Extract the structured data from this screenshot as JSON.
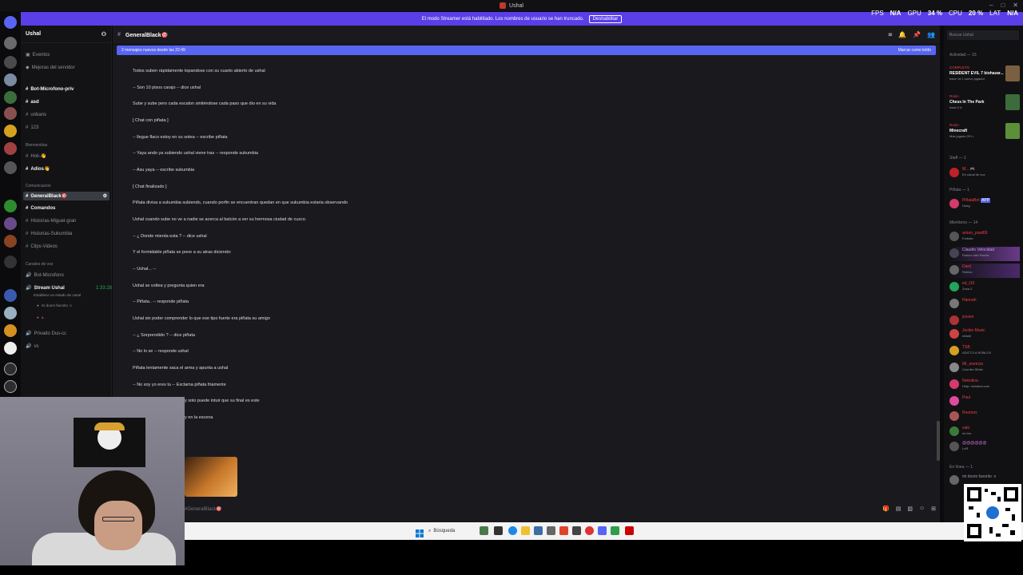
{
  "titlebar": {
    "title": "Ushal"
  },
  "perf": {
    "fps_label": "FPS",
    "fps": "N/A",
    "gpu_label": "GPU",
    "gpu": "34 %",
    "cpu_label": "CPU",
    "cpu": "20 %",
    "lat_label": "LAT",
    "lat": "N/A"
  },
  "streamer_bar": {
    "text": "El modo Streamer está habilitado. Los nombres de usuario se han truncado.",
    "button": "Deshabilitar"
  },
  "server": {
    "name": "Ushal"
  },
  "sidebar": {
    "top": [
      "Eventos",
      "Mejoras del servidor"
    ],
    "channels_a": [
      "Bot-Microfono-priv",
      "asd",
      "unbans",
      "123"
    ],
    "cat_bienvenidas": "Bienvenidas",
    "channels_b": [
      "Holi-👋",
      "Adios👋"
    ],
    "cat_comunicacion": "Comunicacion",
    "active_channel": "GeneralBlack🎯",
    "channels_c": [
      "Comandos",
      "Historias-Miguel-gran",
      "Historias-Sukumbia",
      "Clips-Videos"
    ],
    "cat_voz": "Canales de voz",
    "voice_a": "Bot-Microfono",
    "stream_channel": "Stream Ushal",
    "stream_time": "1:33:28",
    "stream_sub": "Establece un estado de canal",
    "voice_user_1": "mi doom favorito :v",
    "voice_user_2": "u..",
    "voice_b": "Privado Dus-cc",
    "voice_c": "vs"
  },
  "chat": {
    "channel": "GeneralBlack🎯",
    "new_messages": "2 mensajes nuevos desde las 22:49",
    "mark_read": "Marcar como leído",
    "messages": [
      "Todos suben rápidamente topandose con su cuarto abierto de ushal",
      "-- Son 10 pisos carajo -- dice ushal",
      "Sube y sube pero cada escalon sintiéndose cada paso que dio en su vida",
      "[ Chat con piñata ]",
      "-- llegue flaco estoy en su sotea -- escribe piñata",
      "-- Yaya ando ya subiendo ushal viene tras -- responde sukumbia",
      "-- Asu yaya -- escribe sukumbia",
      "[ Chat finalizado ]",
      "Piñata divisa a sukumbia subiendo, cuando porfin se encuentran quedan en que sukumbia estaria observando",
      "Ushal cuando sube no ve a nadie se acerca al balcón a ver su hermosa ciudad de cuzco.",
      "-- ¿ Donde mierda esta ? -- dice ushal",
      "Y el formidable piñata se pone a su atras diciendo:",
      "-- Ushal... --",
      "Ushal se voltea y pregunta quien era",
      "-- Piñata.. -- responde piñata",
      "Ushal sin poder comprender lo que ese tipo fuerte era piñata su amigo",
      "-- ¿ Sorprendido ? -- dice piñata",
      "-- No lo se -- responde ushal",
      "Piñata lentamente saca el arma y apunta a ushal",
      "-- No soy yo eres tu -- Exclama piñata friamente",
      "y solo puede intuir que su final es este",
      "y en la escena"
    ],
    "composer_placeholder": "#GeneralBlack🎯"
  },
  "members": {
    "search_placeholder": "Buscar Ushal",
    "activity_header": "Actividad — 15",
    "activities": [
      {
        "tag": "COMPLETO",
        "title": "RESIDENT EVIL 7 biohazar...",
        "sub": "hace 1d  1 nuevo jugador"
      },
      {
        "tag": "Ronin",
        "title": "Chess In The Park",
        "sub": "hace 2 d"
      },
      {
        "tag": "Ronin",
        "title": "Minecraft",
        "sub": "Más jugado 29 h"
      }
    ],
    "staff_header": "Staff — 1",
    "staff": [
      {
        "name": "M... 🎮",
        "sub": "En canal de voz"
      }
    ],
    "pinata_header": "Piñata — 1",
    "pinata": [
      {
        "name": "PiñataBot",
        "badge": "APP",
        "sub": "Hueg"
      }
    ],
    "members_header": "Miembros — 14",
    "list": [
      {
        "name": "arturo_prad69",
        "sub": "Fortnite"
      },
      {
        "name": "Claudio Velocidad",
        "sub": "Roblox with Rande"
      },
      {
        "name": "Dard",
        "sub": "Roblox"
      },
      {
        "name": "ed_t15",
        "sub": "Zona 2"
      },
      {
        "name": "Hannah",
        "sub": ""
      },
      {
        "name": "jessen",
        "sub": ""
      },
      {
        "name": "Jockie Music",
        "sub": "mfade"
      },
      {
        "name": "TSB",
        "sub": "ADICTO A ROBLOX"
      },
      {
        "name": "Mr_esencia",
        "sub": "Counter-Strike"
      },
      {
        "name": "Nekotina",
        "sub": "Help: nekotina.com"
      },
      {
        "name": "Paul",
        "sub": ""
      },
      {
        "name": "Roomes",
        "sub": ""
      },
      {
        "name": "valo",
        "sub": "en bro"
      },
      {
        "name": "@@@@@@",
        "sub": "LoR"
      }
    ],
    "online_header": "En línea — 1",
    "online": [
      {
        "name": "mi doom favorito :v",
        "sub": ""
      }
    ]
  },
  "taskbar": {
    "search": "Búsqueda"
  },
  "colors": {
    "accent": "#5865f2",
    "streamer": "#5a3ee8",
    "red_name": "#f23f43"
  }
}
